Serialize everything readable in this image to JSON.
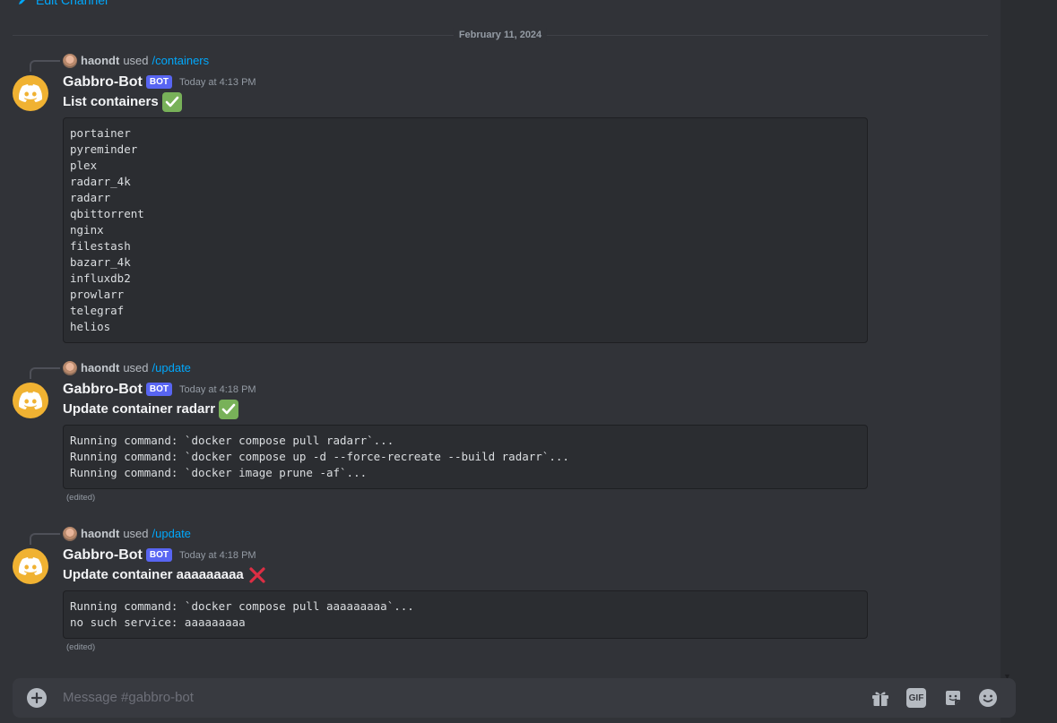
{
  "header": {
    "edit_channel_label": "Edit Channel"
  },
  "date_divider": "February 11, 2024",
  "messages": [
    {
      "reply_user": "haondt",
      "reply_used": "used",
      "reply_command": "/containers",
      "username": "Gabbro-Bot",
      "bot_tag": "BOT",
      "timestamp": "Today at 4:13 PM",
      "title": "List containers",
      "status_icon": "check-mark-icon",
      "code_lines": [
        "portainer",
        "pyreminder",
        "plex",
        "radarr_4k",
        "radarr",
        "qbittorrent",
        "nginx",
        "filestash",
        "bazarr_4k",
        "influxdb2",
        "prowlarr",
        "telegraf",
        "helios"
      ],
      "edited": ""
    },
    {
      "reply_user": "haondt",
      "reply_used": "used",
      "reply_command": "/update",
      "username": "Gabbro-Bot",
      "bot_tag": "BOT",
      "timestamp": "Today at 4:18 PM",
      "title": "Update container radarr",
      "status_icon": "check-mark-icon",
      "code_lines": [
        "Running command: `docker compose pull radarr`...",
        "Running command: `docker compose up -d --force-recreate --build radarr`...",
        "Running command: `docker image prune -af`..."
      ],
      "edited": "(edited)"
    },
    {
      "reply_user": "haondt",
      "reply_used": "used",
      "reply_command": "/update",
      "username": "Gabbro-Bot",
      "bot_tag": "BOT",
      "timestamp": "Today at 4:18 PM",
      "title": "Update container aaaaaaaaa",
      "status_icon": "cross-mark-icon",
      "code_lines": [
        "Running command: `docker compose pull aaaaaaaaa`...",
        "no such service: aaaaaaaaa"
      ],
      "edited": "(edited)"
    }
  ],
  "composer": {
    "placeholder": "Message #gabbro-bot",
    "gif_label": "GIF",
    "tools": [
      "gift-icon",
      "gif-icon",
      "sticker-icon",
      "emoji-icon"
    ]
  },
  "colors": {
    "background": "#313338",
    "link": "#00a8fc",
    "bot_tag": "#5865f2",
    "avatar": "#f0b232",
    "check": "#78b159",
    "cross": "#dd2e44"
  }
}
